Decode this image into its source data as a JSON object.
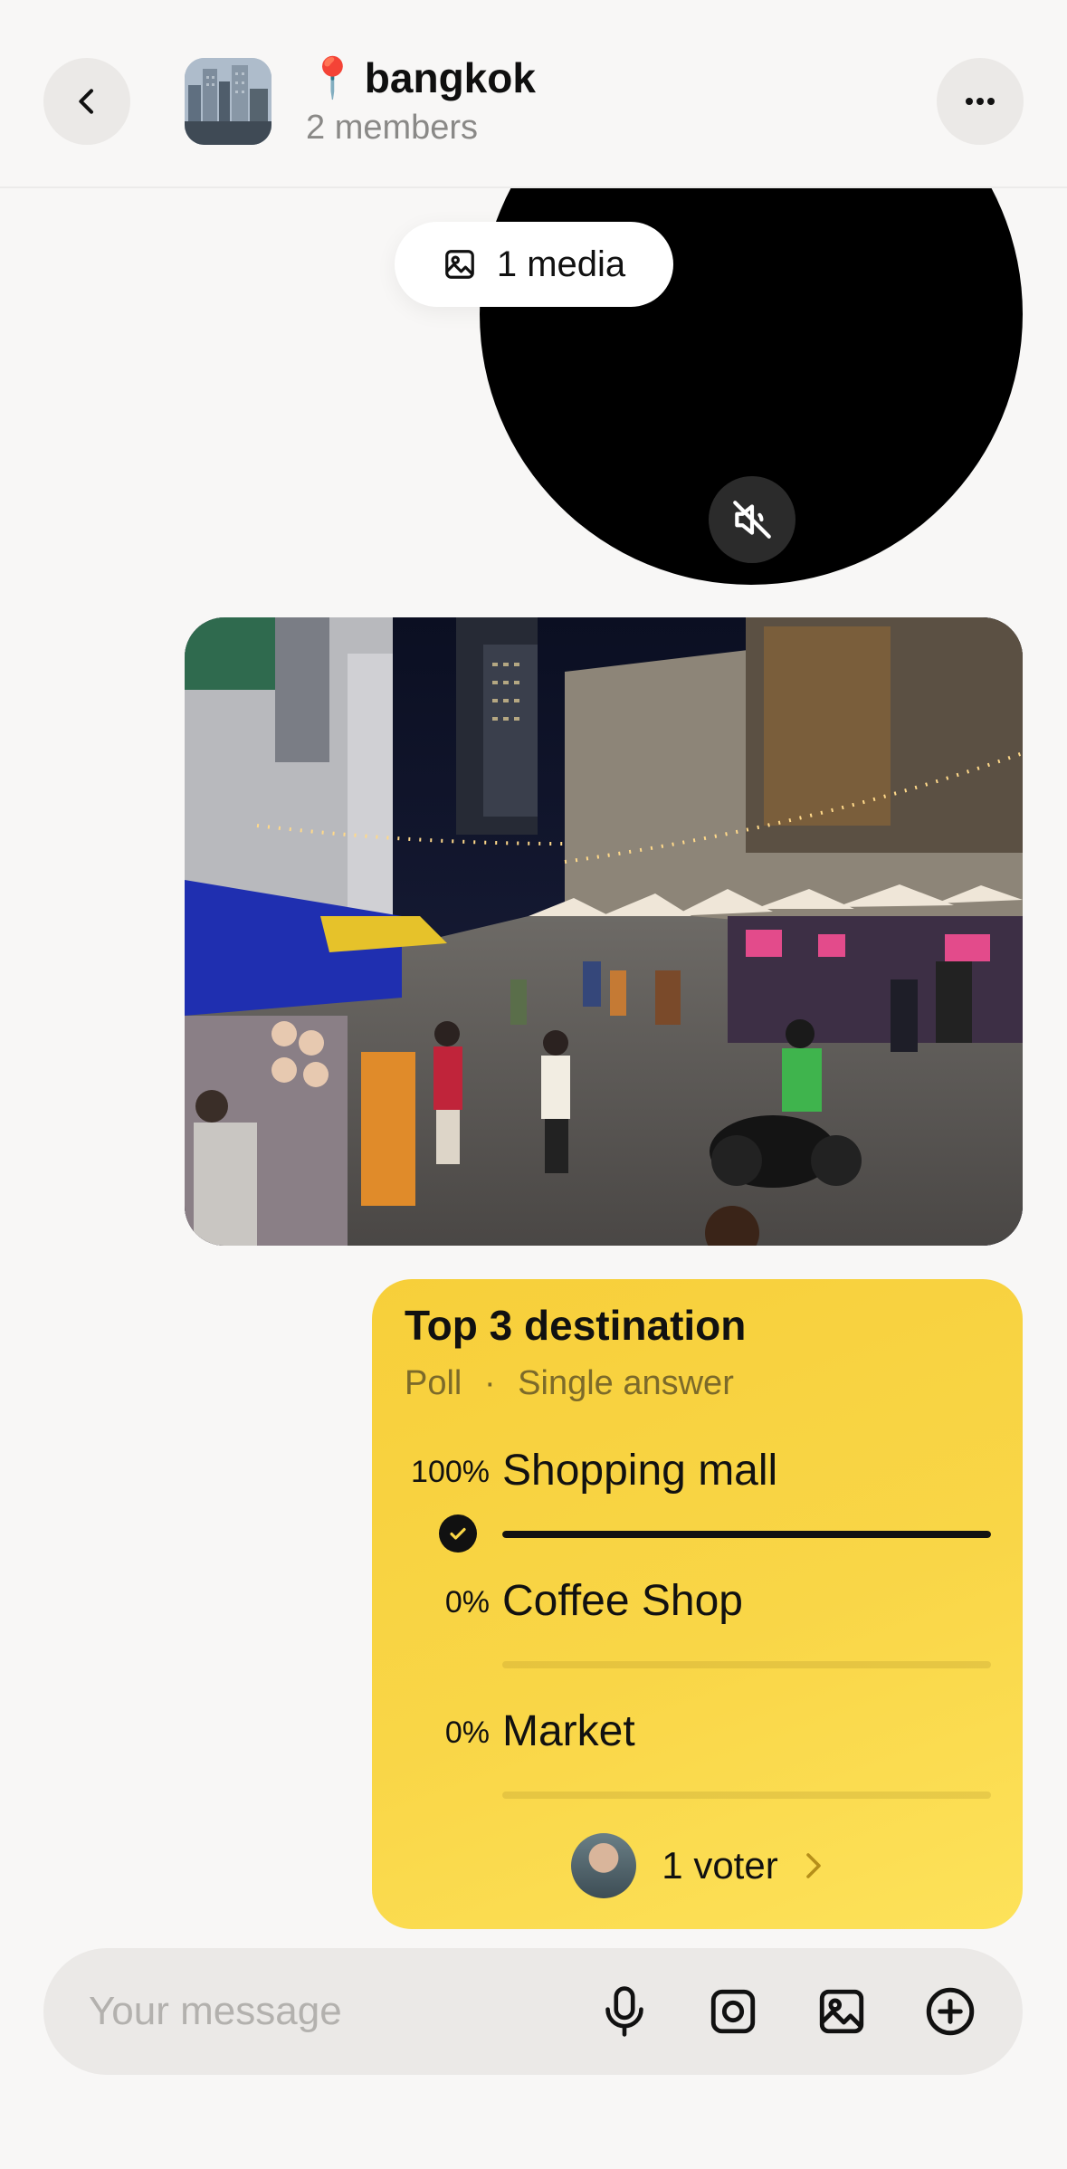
{
  "header": {
    "title": "bangkok",
    "pin_icon": "📍",
    "subtitle": "2 members"
  },
  "media_chip": {
    "label": "1 media"
  },
  "poll": {
    "title": "Top 3 destination",
    "type": "Poll",
    "mode": "Single answer",
    "options": [
      {
        "label": "Shopping mall",
        "percent_label": "100%",
        "percent": 100,
        "selected": true
      },
      {
        "label": "Coffee Shop",
        "percent_label": "0%",
        "percent": 0,
        "selected": false
      },
      {
        "label": "Market",
        "percent_label": "0%",
        "percent": 0,
        "selected": false
      }
    ],
    "voters_label": "1 voter"
  },
  "composer": {
    "placeholder": "Your message"
  },
  "colors": {
    "poll_bg": "#f9d647",
    "page_bg": "#f8f7f6"
  }
}
